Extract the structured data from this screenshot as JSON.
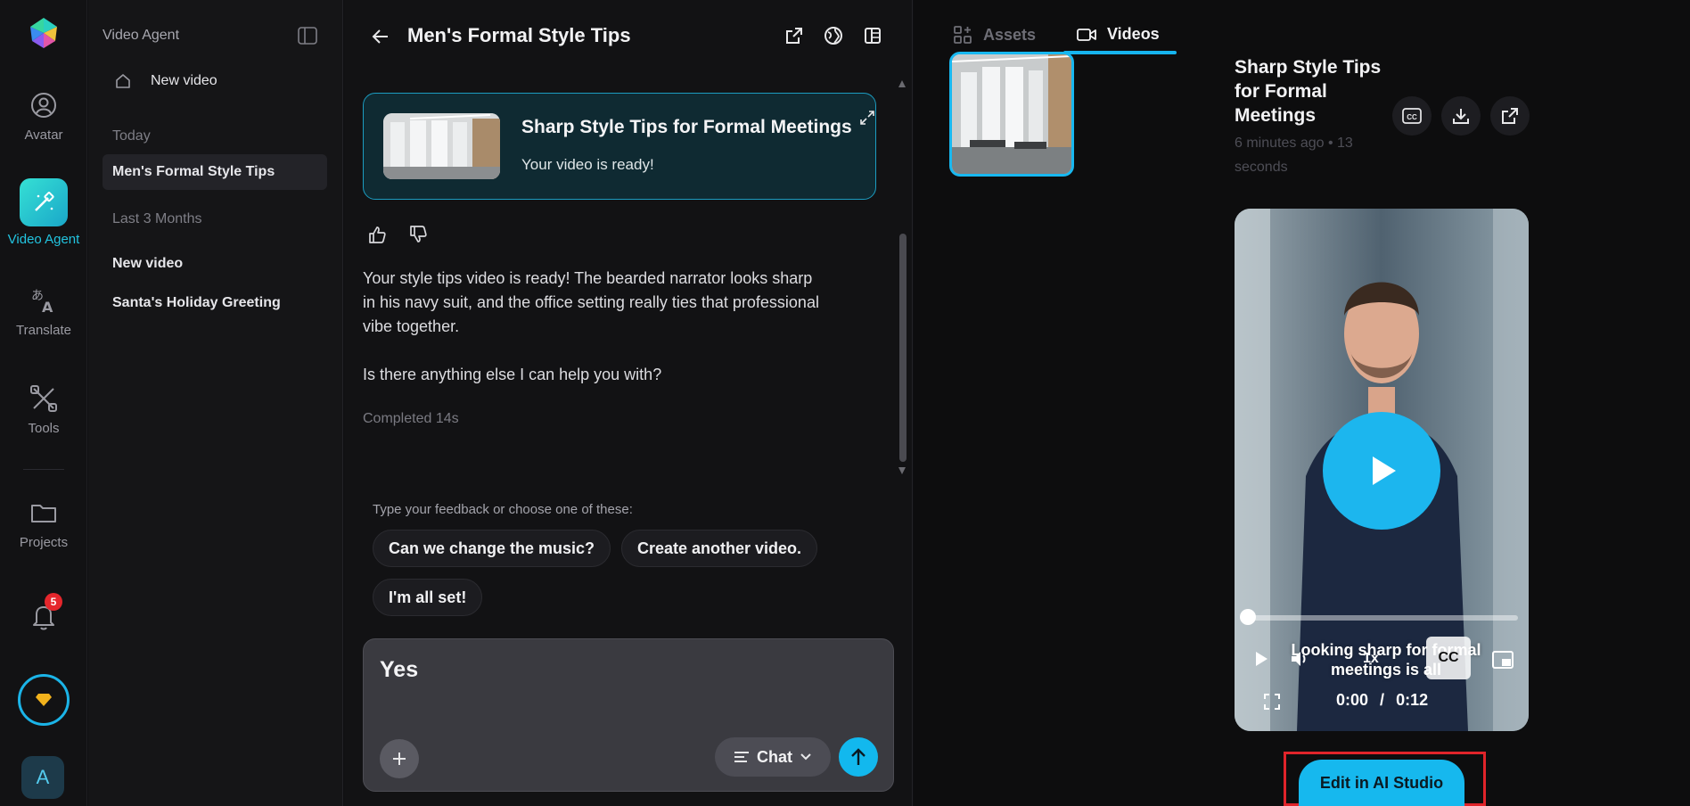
{
  "rail": {
    "items": [
      {
        "label": "Avatar",
        "icon": "avatar-icon"
      },
      {
        "label": "Video Agent",
        "icon": "magic-wand-icon"
      },
      {
        "label": "Translate",
        "icon": "translate-icon"
      },
      {
        "label": "Tools",
        "icon": "tools-icon"
      },
      {
        "label": "Projects",
        "icon": "folder-icon"
      }
    ],
    "notifications_count": "5",
    "user_initial": "A",
    "accent_color": "#22c4e0"
  },
  "sidebar": {
    "title": "Video Agent",
    "new_video": "New video",
    "groups": [
      {
        "label": "Today",
        "items": [
          "Men's Formal Style Tips"
        ]
      },
      {
        "label": "Last 3 Months",
        "items": [
          "New video",
          "Santa's Holiday Greeting"
        ]
      }
    ]
  },
  "chat": {
    "title": "Men's Formal Style Tips",
    "card": {
      "title": "Sharp Style Tips for Formal Meetings",
      "subtitle": "Your video is ready!"
    },
    "message_1": "Your style tips video is ready! The bearded narrator looks sharp in his navy suit, and the office setting really ties that professional vibe together.",
    "message_2": "Is there anything else I can help you with?",
    "completed": "Completed 14s",
    "hint": "Type your feedback or choose one of these:",
    "suggestions": [
      "Can we change the music?",
      "Create another video.",
      "I'm all set!"
    ],
    "input_value": "Yes",
    "mode_label": "Chat"
  },
  "right": {
    "tabs": [
      {
        "label": "Assets",
        "icon": "assets-icon"
      },
      {
        "label": "Videos",
        "icon": "video-camera-icon"
      }
    ],
    "video_title": "Sharp Style Tips for Formal Meetings",
    "video_meta": "6 minutes ago • 13 seconds",
    "player": {
      "caption": "Looking sharp for formal meetings is all",
      "speed": "1x",
      "cc": "CC",
      "current_time": "0:00",
      "separator": "/",
      "duration": "0:12",
      "progress": 0
    },
    "edit_button": "Edit in AI Studio"
  }
}
